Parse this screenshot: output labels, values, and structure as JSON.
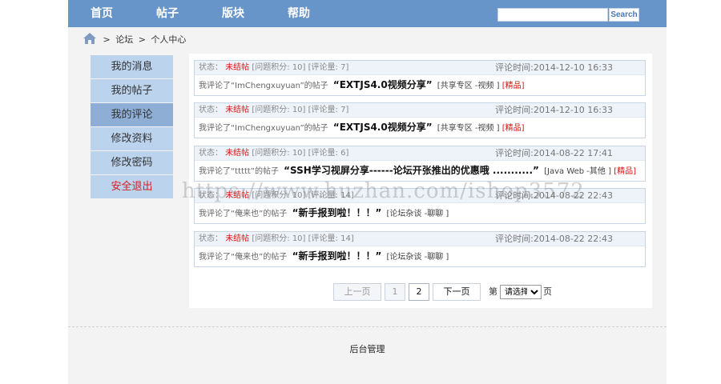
{
  "nav": {
    "items": [
      {
        "label": "首页"
      },
      {
        "label": "帖子"
      },
      {
        "label": "版块"
      },
      {
        "label": "帮助"
      }
    ],
    "search_value": "",
    "search_label": "Search"
  },
  "breadcrumb": {
    "forum": "论坛",
    "sep": ">",
    "current": "个人中心"
  },
  "sidebar": {
    "items": [
      {
        "label": "我的消息"
      },
      {
        "label": "我的帖子"
      },
      {
        "label": "我的评论"
      },
      {
        "label": "修改资料"
      },
      {
        "label": "修改密码"
      },
      {
        "label": "安全退出"
      }
    ],
    "active_index": 2
  },
  "comments": [
    {
      "status_label": "状态：",
      "status": "未结帖",
      "score": "[问题积分: 10]",
      "count": "[评论量: 7]",
      "time": "评论时间:2014-12-10 16:33",
      "prefix": "我评论了“ImChengxuyuan”的帖子",
      "title": "“EXTJS4.0视频分享”",
      "tag": "[共享专区 -视频 ]",
      "tag2": "[精品]"
    },
    {
      "status_label": "状态：",
      "status": "未结帖",
      "score": "[问题积分: 10]",
      "count": "[评论量: 7]",
      "time": "评论时间:2014-12-10 16:33",
      "prefix": "我评论了“ImChengxuyuan”的帖子",
      "title": "“EXTJS4.0视频分享”",
      "tag": "[共享专区 -视频 ]",
      "tag2": "[精品]"
    },
    {
      "status_label": "状态：",
      "status": "未结帖",
      "score": "[问题积分: 10]",
      "count": "[评论量: 6]",
      "time": "评论时间:2014-08-22 17:41",
      "prefix": "我评论了“ttttt”的帖子",
      "title": "“SSH学习视屏分享------论坛开张推出的优惠哦 ...........”",
      "tag": "[Java Web -其他 ]",
      "tag2": "[精品]"
    },
    {
      "status_label": "状态：",
      "status": "未结帖",
      "score": "[问题积分: 10]",
      "count": "[评论量: 14]",
      "time": "评论时间:2014-08-22 22:43",
      "prefix": "我评论了“俺来也”的帖子",
      "title": "“新手报到啦！！！”",
      "tag": "[论坛杂谈 -聊聊 ]",
      "tag2": ""
    },
    {
      "status_label": "状态：",
      "status": "未结帖",
      "score": "[问题积分: 10]",
      "count": "[评论量: 14]",
      "time": "评论时间:2014-08-22 22:43",
      "prefix": "我评论了“俺来也”的帖子",
      "title": "“新手报到啦！！！”",
      "tag": "[论坛杂谈 -聊聊 ]",
      "tag2": ""
    }
  ],
  "pager": {
    "prev": "上一页",
    "page1": "1",
    "page2": "2",
    "next": "下一页",
    "di": "第",
    "select_value": "请选择",
    "ye": "页"
  },
  "footer": {
    "link": "后台管理"
  },
  "watermark": "https://www.huzhan.com/ishop3572",
  "colors": {
    "nav": "#6795c9",
    "sidebar": "#bcd3ee",
    "sidebar_active": "#8eaed6",
    "status": "#dd1111"
  }
}
